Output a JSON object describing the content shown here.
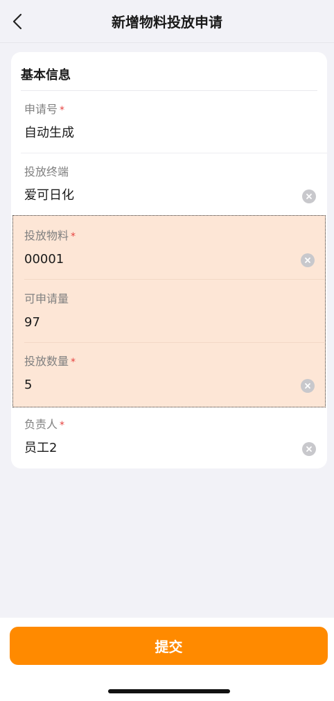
{
  "header": {
    "title": "新增物料投放申请"
  },
  "section": {
    "title": "基本信息"
  },
  "fields": {
    "application_no": {
      "label": "申请号",
      "required": "*",
      "value": "自动生成"
    },
    "terminal": {
      "label": "投放终端",
      "value": "爱可日化"
    },
    "material": {
      "label": "投放物料",
      "required": "*",
      "value": "00001"
    },
    "available_qty": {
      "label": "可申请量",
      "value": "97"
    },
    "quantity": {
      "label": "投放数量",
      "required": "*",
      "value": "5"
    },
    "owner": {
      "label": "负责人",
      "required": "*",
      "value": "员工2"
    }
  },
  "footer": {
    "submit_label": "提交"
  },
  "colors": {
    "accent": "#ff8a00",
    "required": "#e64340",
    "highlight": "#fde6d6"
  }
}
